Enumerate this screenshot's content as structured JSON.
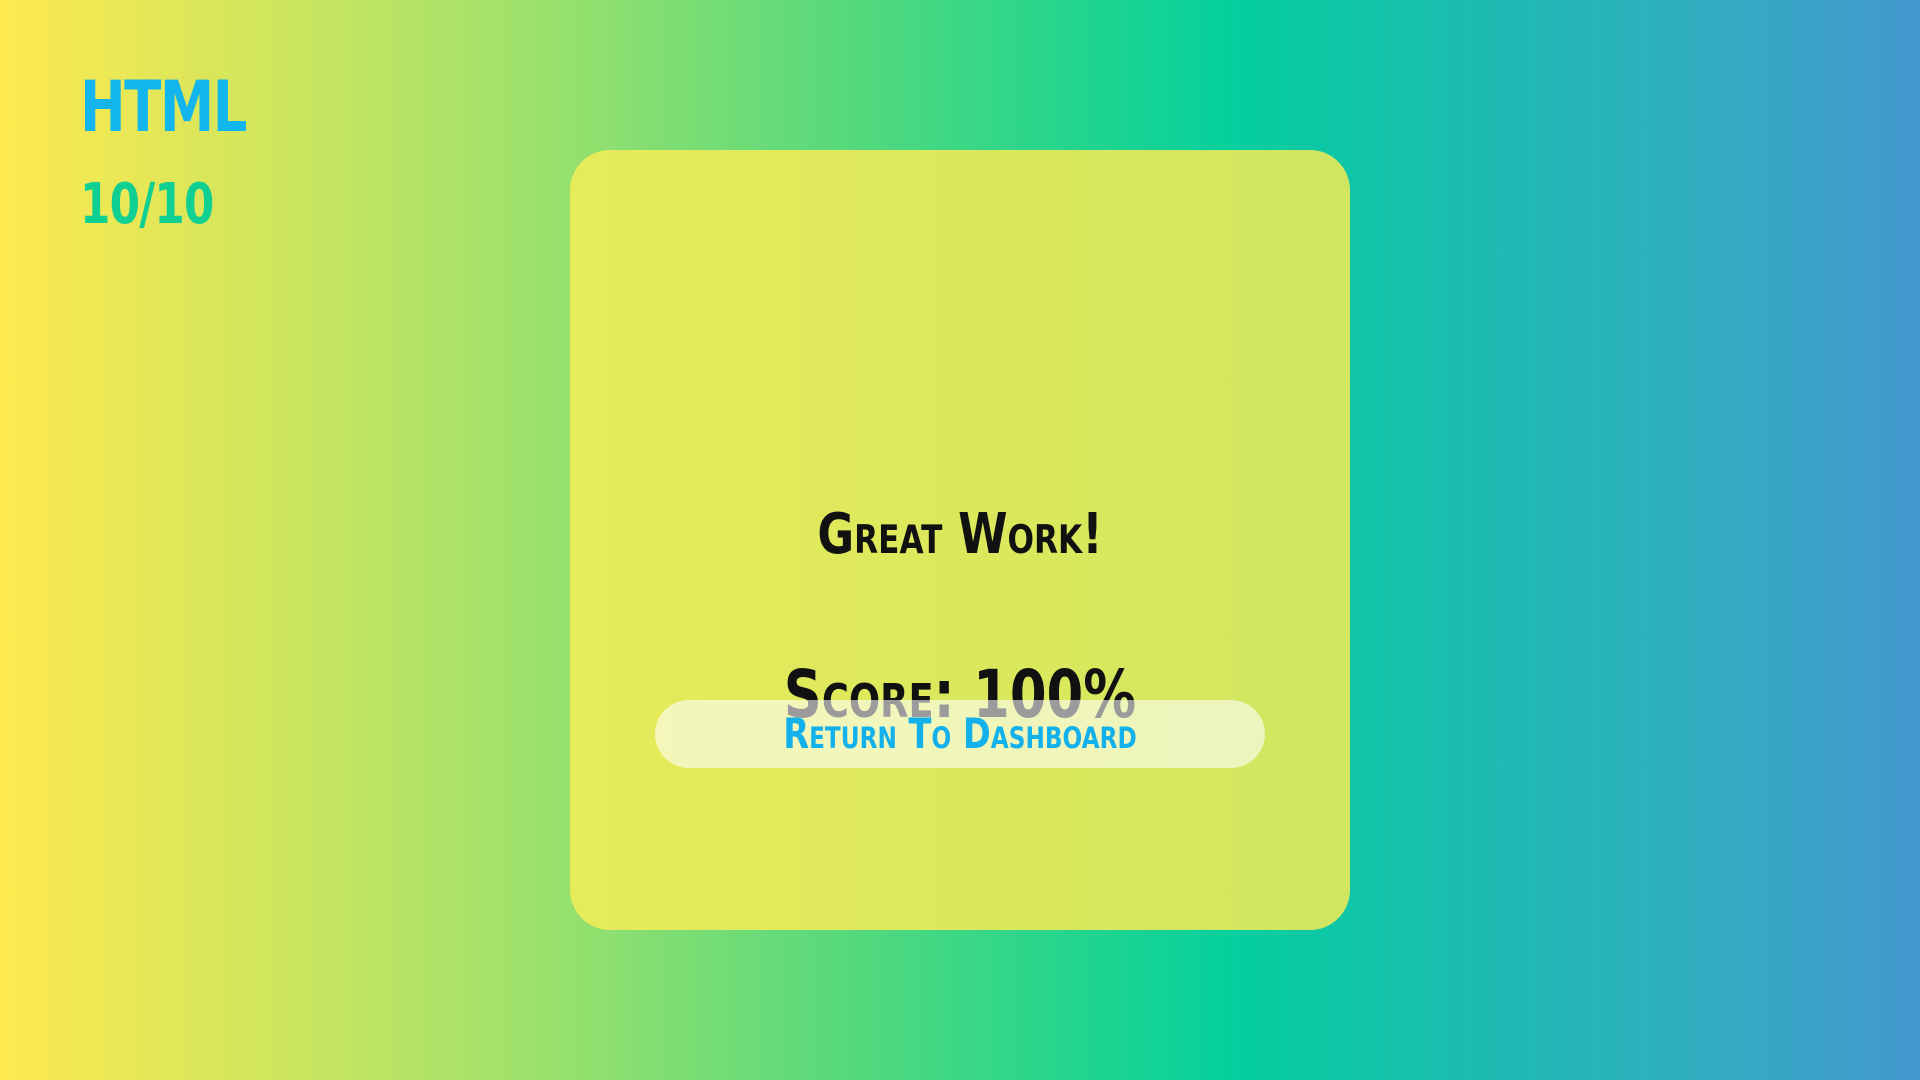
{
  "header": {
    "topic": "HTML",
    "progress": "10/10"
  },
  "result": {
    "title": "Great Work!",
    "score": "Score: 100%",
    "return_button_label": "Return To Dashboard"
  },
  "colors": {
    "accent_blue": "#12b6ec",
    "accent_green": "#10cf93",
    "card_background": "#dbe85c"
  }
}
